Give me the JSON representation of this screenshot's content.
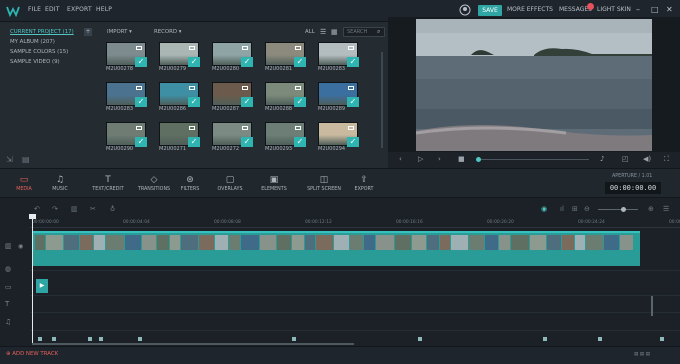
{
  "titlebar": {
    "menus": [
      "FILE",
      "EDIT",
      "EXPORT",
      "HELP"
    ],
    "save_label": "SAVE",
    "more_effects": "MORE EFFECTS",
    "messages": "MESSAGES",
    "light_skin": "LIGHT SKIN",
    "minimize": "–",
    "maximize": "□",
    "close": "✕"
  },
  "library": {
    "sidebar": [
      {
        "label": "CURRENT PROJECT (17)",
        "active": true
      },
      {
        "label": "MY ALBUM (207)"
      },
      {
        "label": "SAMPLE COLORS (15)"
      },
      {
        "label": "SAMPLE VIDEO (9)"
      }
    ],
    "add_label": "+",
    "import_label": "IMPORT",
    "record_label": "RECORD",
    "all_label": "ALL",
    "search_placeholder": "SEARCH",
    "clips": [
      {
        "name": "M2U00278",
        "color": "#7d8a8e"
      },
      {
        "name": "M2U00279",
        "color": "#a9b6b4"
      },
      {
        "name": "M2U00280",
        "color": "#8ea4a5"
      },
      {
        "name": "M2U00281",
        "color": "#8c8a7d"
      },
      {
        "name": "M2U00283",
        "color": "#b3bcbf"
      },
      {
        "name": "M2U00283",
        "color": "#4b7390"
      },
      {
        "name": "M2U00286",
        "color": "#3e8fa4"
      },
      {
        "name": "M2U00287",
        "color": "#6c5b4d"
      },
      {
        "name": "M2U00288",
        "color": "#7c8a7b"
      },
      {
        "name": "M2U00289",
        "color": "#3b6fa0"
      },
      {
        "name": "M2U00290",
        "color": "#6e7c74"
      },
      {
        "name": "M2U00271",
        "color": "#5f6f62"
      },
      {
        "name": "M2U00272",
        "color": "#7b8b84"
      },
      {
        "name": "M2U00293",
        "color": "#6c7e76"
      },
      {
        "name": "M2U00294",
        "color": "#c8b99f"
      }
    ]
  },
  "toolbar": {
    "tools": [
      {
        "label": "MEDIA",
        "icon": "folder-icon",
        "glyph": "▭",
        "active": true
      },
      {
        "label": "MUSIC",
        "icon": "music-icon",
        "glyph": "♫"
      },
      {
        "label": "TEXT/CREDIT",
        "icon": "text-icon",
        "glyph": "T"
      },
      {
        "label": "TRANSITIONS",
        "icon": "transition-icon",
        "glyph": "◇"
      },
      {
        "label": "FILTERS",
        "icon": "filter-icon",
        "glyph": "⊛"
      },
      {
        "label": "OVERLAYS",
        "icon": "overlay-icon",
        "glyph": "▢"
      },
      {
        "label": "ELEMENTS",
        "icon": "image-icon",
        "glyph": "▣"
      },
      {
        "label": "SPLIT SCREEN",
        "icon": "split-screen-icon",
        "glyph": "◫"
      },
      {
        "label": "EXPORT",
        "icon": "export-icon",
        "glyph": "⇪"
      }
    ],
    "timecode": "00:00:00.00"
  },
  "timeline": {
    "ruler_ticks": [
      "00:00:00:00",
      "00:00:04:04",
      "00:00:08:08",
      "00:00:12:12",
      "00:00:16:16",
      "00:00:20:20",
      "00:00:24:24",
      "00:00:28:28"
    ],
    "add_track_label": "ADD NEW TRACK"
  }
}
